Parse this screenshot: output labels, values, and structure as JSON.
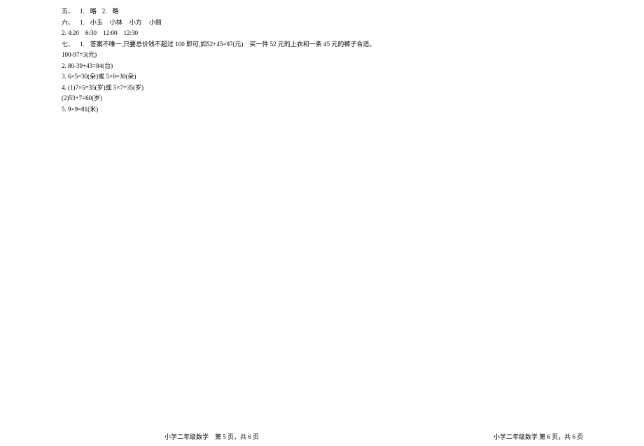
{
  "lines": {
    "l1_a": "五、",
    "l1_b": "1.",
    "l1_c": "略",
    "l1_d": "2.",
    "l1_e": "略",
    "l2_a": "六、",
    "l2_b": "1.",
    "l2_c": "小玉",
    "l2_d": "小林",
    "l2_e": "小方",
    "l2_f": "小丽",
    "l3": "2. 4:20　6:30　12:00　12:30",
    "l4_a": "七、",
    "l4_b": "1.",
    "l4_c": "答案不唯一,只要总价钱不超过 100 即可,如52+45=97(元)　买一件 52 元的上衣和一条 45 元的裤子合适。",
    "l5": "100-97=3(元)",
    "l6": "2. 80-39+43=84(台)",
    "l7": "3. 6×5=30(朵)或 5×6=30(朵)",
    "l8": "4. (1)7×5=35(岁)或 5×7=35(岁)",
    "l9": "(2)53+7=60(岁)",
    "l10": "5. 9×9=81(米)"
  },
  "footer": {
    "left": "小学二年级数学　第 5 页，共 6 页",
    "right": "小学二年级数学  第 6 页，共 6 页"
  }
}
